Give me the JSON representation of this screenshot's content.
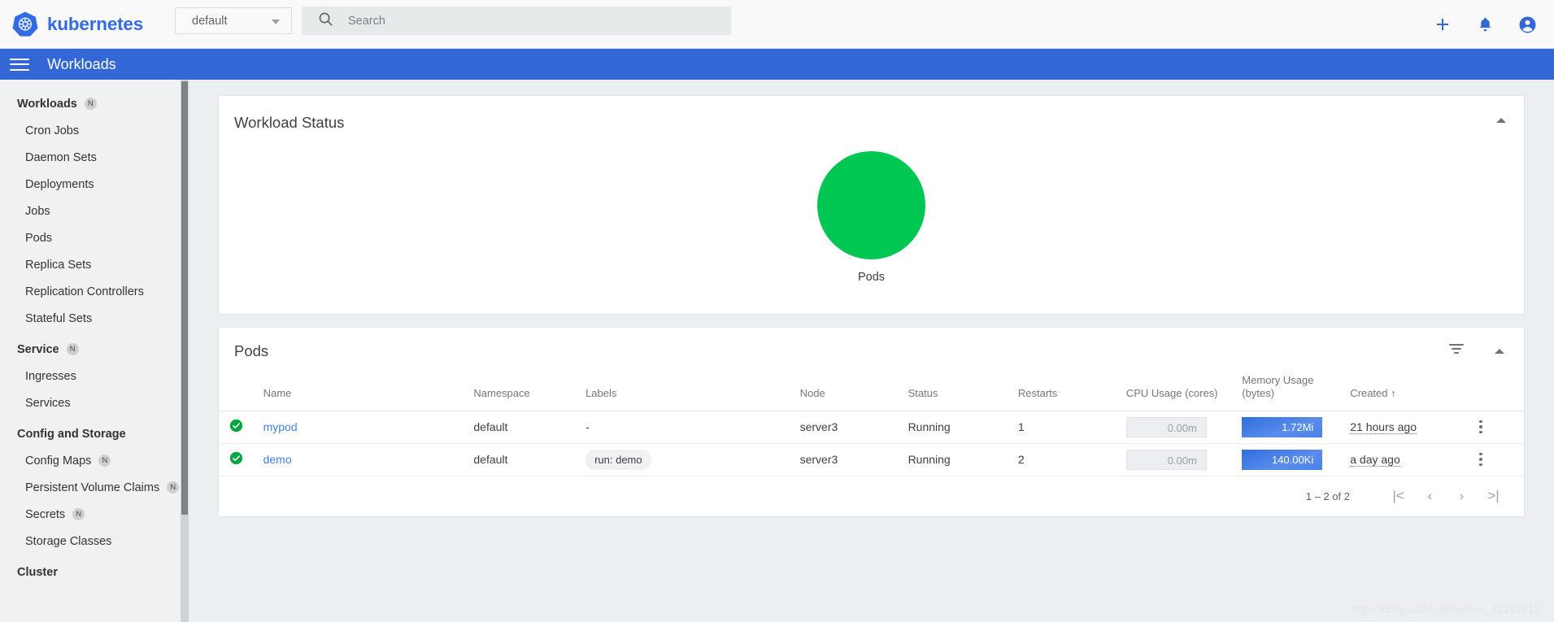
{
  "header": {
    "brand": "kubernetes",
    "logo_icon": "kubernetes-helm-logo",
    "namespace": {
      "value": "default",
      "caret_icon": "chevron-down-icon"
    },
    "search": {
      "value": "",
      "placeholder": "Search",
      "icon": "search-icon"
    },
    "actions": [
      {
        "name": "create-button",
        "icon": "plus-icon"
      },
      {
        "name": "notifications-button",
        "icon": "bell-icon"
      },
      {
        "name": "account-button",
        "icon": "account-circle-icon"
      }
    ],
    "accent_color": "#326ce5"
  },
  "toolbar": {
    "menu_icon": "hamburger-menu-icon",
    "title": "Workloads",
    "background_color": "#3367d6"
  },
  "sidebar": {
    "items": [
      {
        "label": "Workloads",
        "badge": "N",
        "active": true,
        "type": "header"
      },
      {
        "label": "Cron Jobs",
        "badge": "",
        "type": "item"
      },
      {
        "label": "Daemon Sets",
        "badge": "",
        "type": "item"
      },
      {
        "label": "Deployments",
        "badge": "",
        "type": "item"
      },
      {
        "label": "Jobs",
        "badge": "",
        "type": "item"
      },
      {
        "label": "Pods",
        "badge": "",
        "type": "item"
      },
      {
        "label": "Replica Sets",
        "badge": "",
        "type": "item"
      },
      {
        "label": "Replication Controllers",
        "badge": "",
        "type": "item"
      },
      {
        "label": "Stateful Sets",
        "badge": "",
        "type": "item"
      },
      {
        "label": "Service",
        "badge": "N",
        "type": "header"
      },
      {
        "label": "Ingresses",
        "badge": "",
        "type": "item"
      },
      {
        "label": "Services",
        "badge": "",
        "type": "item"
      },
      {
        "label": "Config and Storage",
        "badge": "",
        "type": "header"
      },
      {
        "label": "Config Maps",
        "badge": "N",
        "type": "item"
      },
      {
        "label": "Persistent Volume Claims",
        "badge": "N",
        "type": "item"
      },
      {
        "label": "Secrets",
        "badge": "N",
        "type": "item"
      },
      {
        "label": "Storage Classes",
        "badge": "",
        "type": "item"
      },
      {
        "label": "Cluster",
        "badge": "",
        "type": "header"
      }
    ]
  },
  "workload_status": {
    "title": "Workload Status",
    "collapse_icon": "chevron-up-icon",
    "chart_data": {
      "type": "pie",
      "title": "Workload Status",
      "categories": [
        "Pods"
      ],
      "values": [
        100
      ],
      "labels": [
        "Pods"
      ],
      "colors": [
        "#00c752"
      ],
      "legend_position": "bottom",
      "grid": false,
      "note": "Single full-circle donut: 100% of pods Running (2 of 2)"
    }
  },
  "pods_card": {
    "title": "Pods",
    "filter_icon": "filter-list-icon",
    "collapse_icon": "chevron-up-icon",
    "columns": [
      "",
      "Name",
      "Namespace",
      "Labels",
      "Node",
      "Status",
      "Restarts",
      "CPU Usage (cores)",
      "Memory Usage\n(bytes)",
      "Created",
      ""
    ],
    "column_headers": {
      "name": "Name",
      "namespace": "Namespace",
      "labels": "Labels",
      "node": "Node",
      "status": "Status",
      "restarts": "Restarts",
      "cpu": "CPU Usage (cores)",
      "memory_line1": "Memory Usage",
      "memory_line2": "(bytes)",
      "created": "Created",
      "created_sort": "↑"
    },
    "rows": [
      {
        "status_icon": "check-circle-icon",
        "name": "mypod",
        "namespace": "default",
        "labels": "-",
        "has_chip": false,
        "node": "server3",
        "status": "Running",
        "restarts": "1",
        "cpu": "0.00m",
        "memory": "1.72Mi",
        "created": "21 hours ago"
      },
      {
        "status_icon": "check-circle-icon",
        "name": "demo",
        "namespace": "default",
        "labels": "run: demo",
        "has_chip": true,
        "node": "server3",
        "status": "Running",
        "restarts": "2",
        "cpu": "0.00m",
        "memory": "140.00Ki",
        "created": "a day ago"
      }
    ],
    "pagination": {
      "range": "1 – 2 of 2",
      "first": "|<",
      "prev": "‹",
      "next": "›",
      "last": ">|"
    },
    "status_ok_color": "#00a63f",
    "link_color": "#3f7fe8"
  },
  "watermark": "https://blog.csdn.net/weixin_41191813"
}
